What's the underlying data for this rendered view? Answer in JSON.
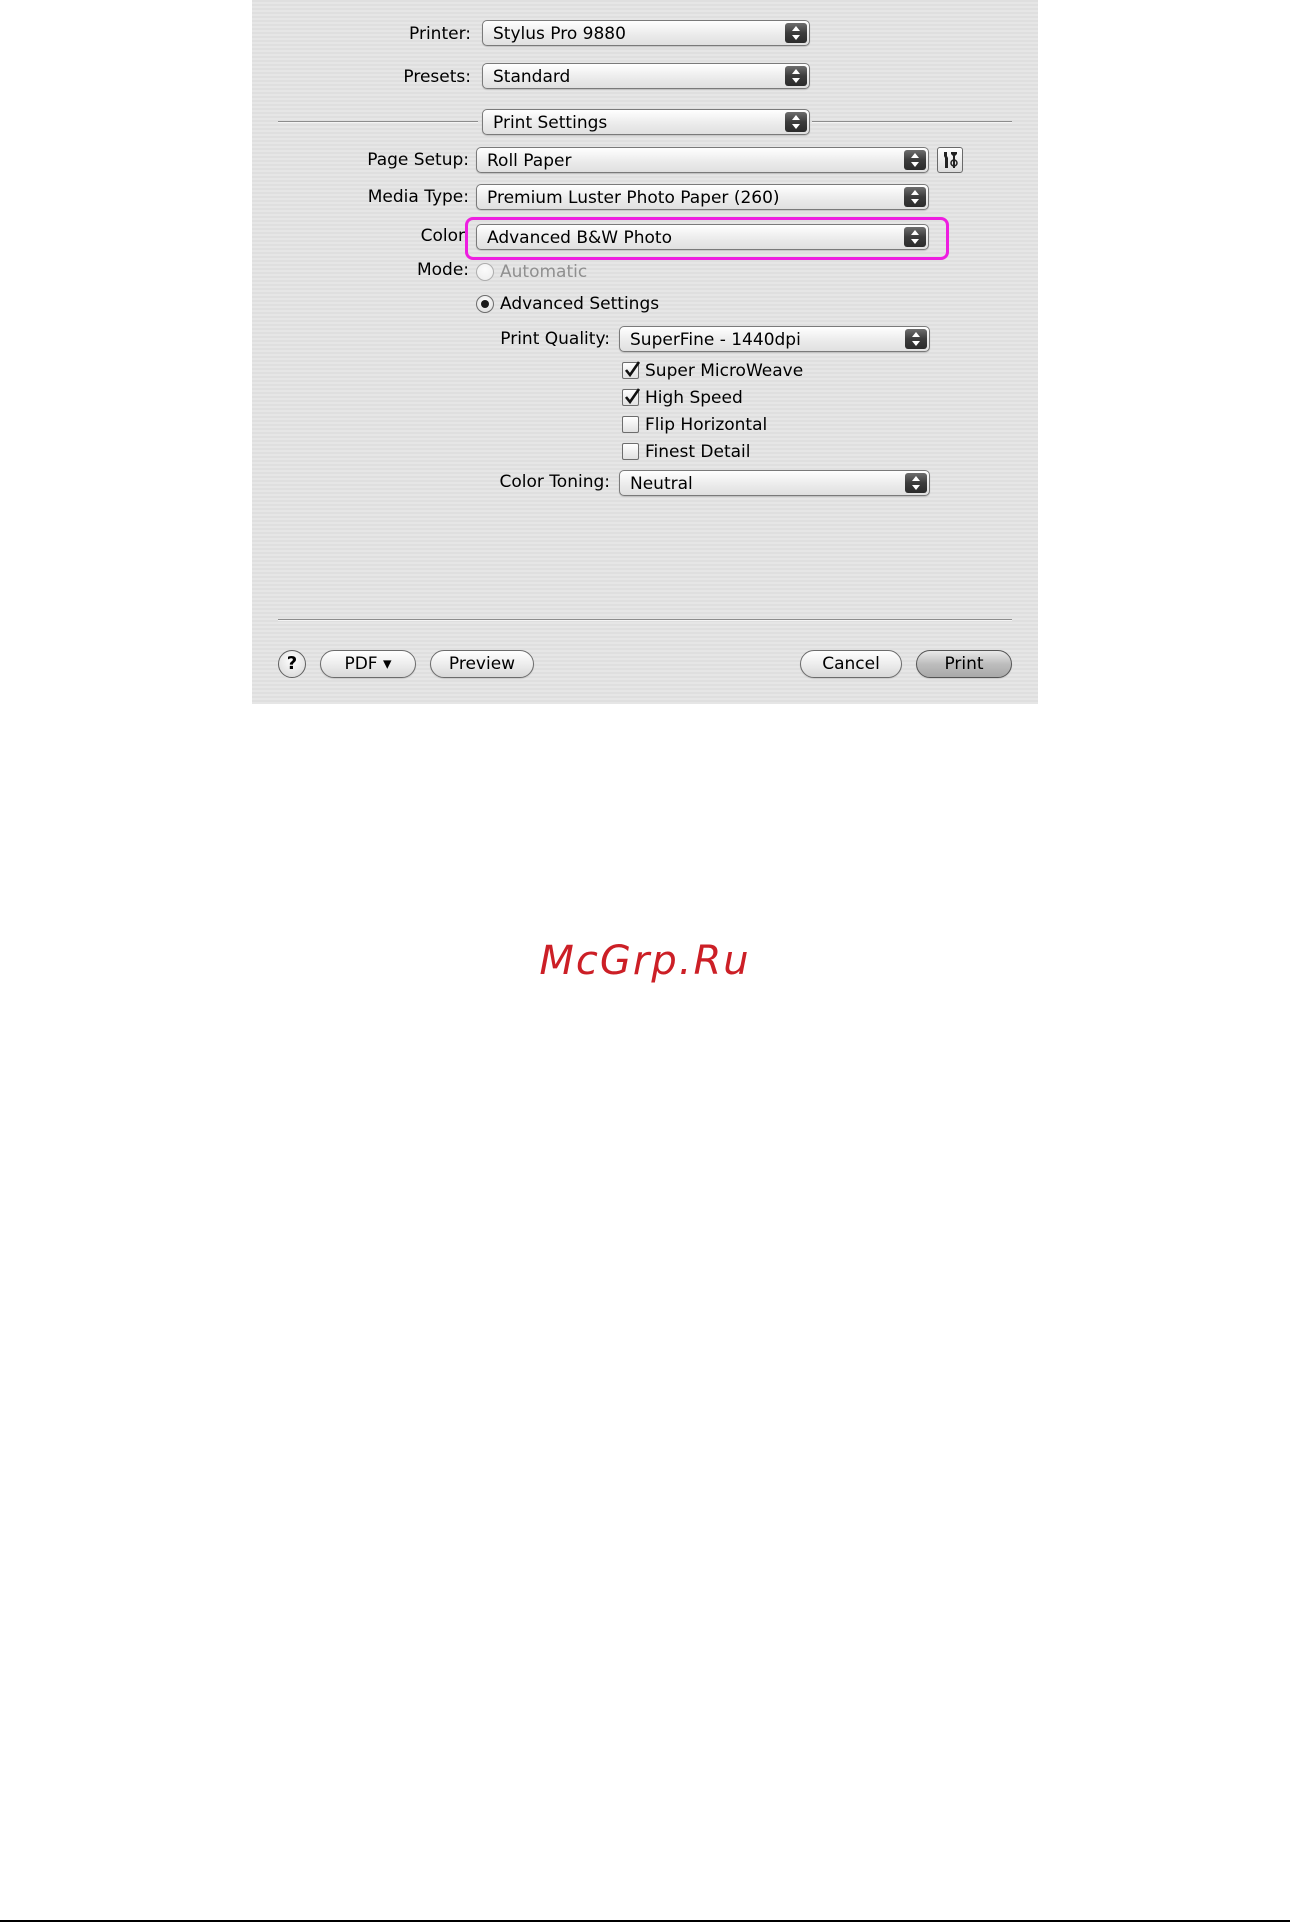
{
  "dialog": {
    "printer": {
      "label": "Printer:",
      "value": "Stylus Pro 9880"
    },
    "presets": {
      "label": "Presets:",
      "value": "Standard"
    },
    "panel": {
      "value": "Print Settings"
    },
    "page_setup": {
      "label": "Page Setup:",
      "value": "Roll Paper"
    },
    "media_type": {
      "label": "Media Type:",
      "value": "Premium Luster Photo Paper (260)"
    },
    "color": {
      "label": "Color",
      "value": "Advanced B&W Photo"
    },
    "mode": {
      "label": "Mode:",
      "automatic": {
        "label": "Automatic",
        "checked": false,
        "enabled": false
      },
      "advanced": {
        "label": "Advanced Settings",
        "checked": true
      }
    },
    "print_quality": {
      "label": "Print Quality:",
      "value": "SuperFine - 1440dpi"
    },
    "checkboxes": [
      {
        "label": "Super MicroWeave",
        "checked": true
      },
      {
        "label": "High Speed",
        "checked": true
      },
      {
        "label": "Flip Horizontal",
        "checked": false
      },
      {
        "label": "Finest Detail",
        "checked": false
      }
    ],
    "color_toning": {
      "label": "Color Toning:",
      "value": "Neutral"
    },
    "buttons": {
      "help": "?",
      "pdf": "PDF ▾",
      "preview": "Preview",
      "cancel": "Cancel",
      "print": "Print"
    },
    "colors": {
      "highlight": "#ee1ee0"
    }
  },
  "watermark": {
    "text": "McGrp.Ru",
    "color": "#cc1f26"
  }
}
